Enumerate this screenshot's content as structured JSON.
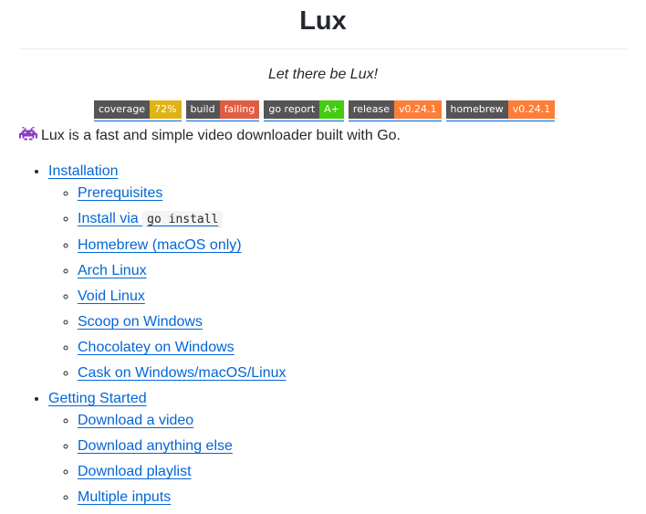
{
  "readme": {
    "title": "Lux",
    "tagline": "Let there be Lux!",
    "intro": "Lux is a fast and simple video downloader built with Go.",
    "badges": [
      {
        "label": "coverage",
        "value": "72%",
        "color": "#dfb317"
      },
      {
        "label": "build",
        "value": "failing",
        "color": "#e05d44"
      },
      {
        "label": "go report",
        "value": "A+",
        "color": "#4c1"
      },
      {
        "label": "release",
        "value": "v0.24.1",
        "color": "#fe7d37"
      },
      {
        "label": "homebrew",
        "value": "v0.24.1",
        "color": "#fe7d37"
      }
    ]
  },
  "toc": {
    "installation": {
      "label": "Installation",
      "items": {
        "prerequisites": "Prerequisites",
        "install_via_prefix": "Install via ",
        "install_via_code": "go install",
        "homebrew": "Homebrew (macOS only)",
        "arch": "Arch Linux",
        "void": "Void Linux",
        "scoop": "Scoop on Windows",
        "chocolatey": "Chocolatey on Windows",
        "cask": "Cask on Windows/macOS/Linux"
      }
    },
    "getting_started": {
      "label": "Getting Started",
      "items": {
        "download_video": "Download a video",
        "download_anything": "Download anything else",
        "download_playlist": "Download playlist",
        "multiple_inputs": "Multiple inputs"
      }
    }
  },
  "icons": {
    "intro_icon": "space-invader-icon"
  }
}
